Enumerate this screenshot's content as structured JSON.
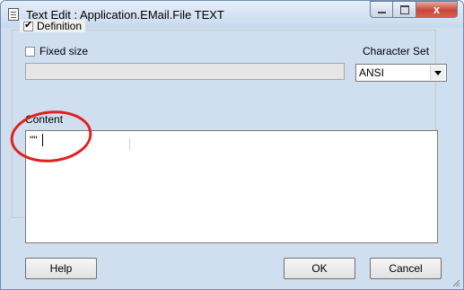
{
  "window": {
    "title": "Text Edit : Application.EMail.File TEXT",
    "close_glyph": "x"
  },
  "definition": {
    "label": "Definition",
    "checked": true
  },
  "fixed_size": {
    "label": "Fixed size",
    "checked": false
  },
  "charset": {
    "label": "Character Set",
    "selected": "ANSI"
  },
  "content": {
    "label": "Content",
    "value": "\"\""
  },
  "buttons": {
    "help": "Help",
    "ok": "OK",
    "cancel": "Cancel"
  },
  "annotation": {
    "color": "#e02020"
  }
}
